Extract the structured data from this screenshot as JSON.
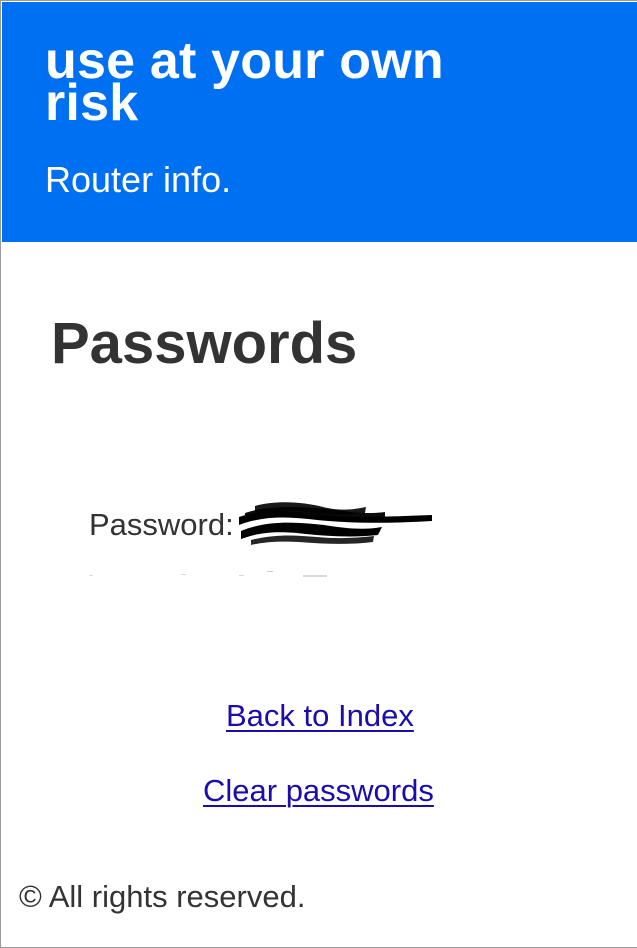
{
  "header": {
    "title": "use at your own risk",
    "subtitle": "Router info."
  },
  "main": {
    "heading": "Passwords",
    "password_label": "Password:"
  },
  "links": {
    "back": "Back to Index",
    "clear": "Clear passwords"
  },
  "footer": {
    "copyright": "© All rights reserved."
  },
  "colors": {
    "header_bg": "#0070f3",
    "link": "#1a0dab",
    "body_text": "#333333"
  }
}
